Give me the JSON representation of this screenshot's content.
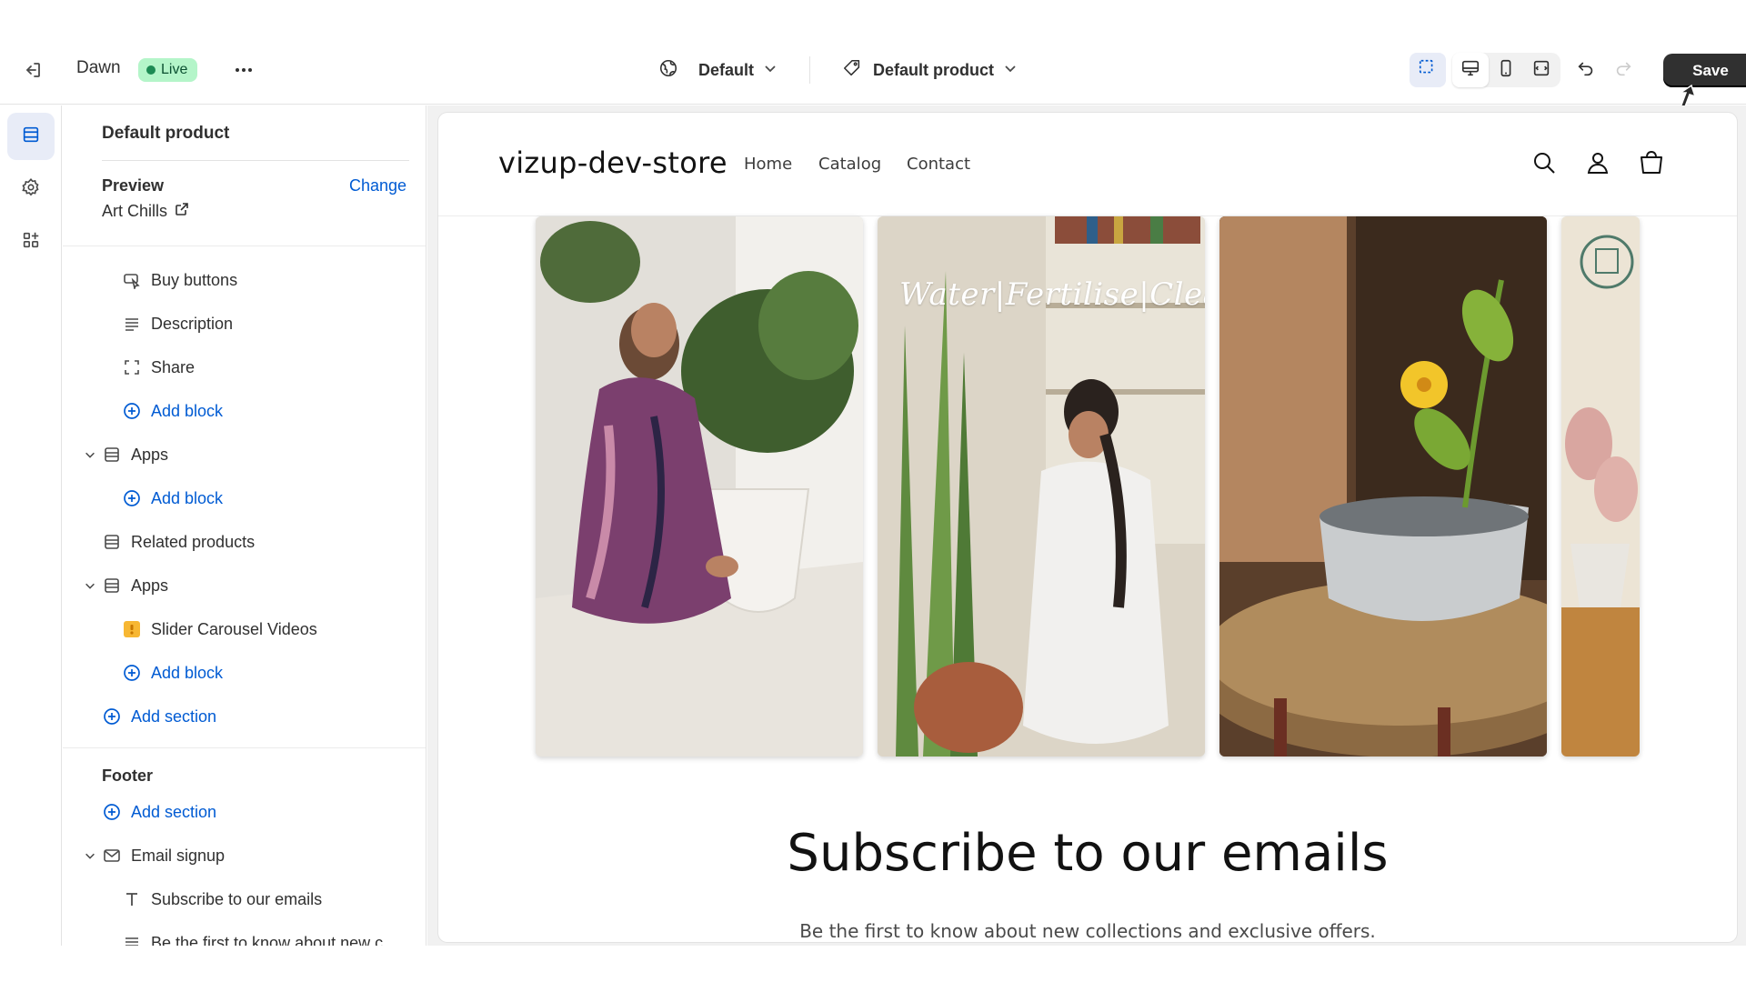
{
  "topbar": {
    "theme_name": "Dawn",
    "live_badge": "Live",
    "template_select": "Default",
    "page_select": "Default product",
    "save_label": "Save"
  },
  "sidebar": {
    "title": "Default product",
    "preview_label": "Preview",
    "change_label": "Change",
    "preview_value": "Art Chills",
    "rows": [
      {
        "label": "Buy buttons",
        "icon": "buy-buttons-icon"
      },
      {
        "label": "Description",
        "icon": "text-lines-icon"
      },
      {
        "label": "Share",
        "icon": "share-frame-icon"
      },
      {
        "label": "Add block",
        "icon": "plus-circle-icon"
      },
      {
        "label": "Apps",
        "icon": "section-icon"
      },
      {
        "label": "Add block",
        "icon": "plus-circle-icon"
      },
      {
        "label": "Related products",
        "icon": "section-icon"
      },
      {
        "label": "Apps",
        "icon": "section-icon"
      },
      {
        "label": "Slider Carousel Videos",
        "icon": "app-block-icon"
      },
      {
        "label": "Add block",
        "icon": "plus-circle-icon"
      },
      {
        "label": "Add section",
        "icon": "plus-circle-icon"
      }
    ],
    "footer_label": "Footer",
    "footer_rows": [
      {
        "label": "Add section",
        "icon": "plus-circle-icon"
      },
      {
        "label": "Email signup",
        "icon": "mail-icon"
      },
      {
        "label": "Subscribe to our emails",
        "icon": "heading-t-icon"
      },
      {
        "label": "Be the first to know about new c",
        "icon": "text-lines-icon"
      }
    ]
  },
  "store": {
    "name": "vizup-dev-store",
    "nav": [
      "Home",
      "Catalog",
      "Contact"
    ],
    "video_overlay_text": "Water|Fertilise|Clean",
    "subscribe_title": "Subscribe to our emails",
    "subscribe_text": "Be the first to know about new collections and exclusive offers."
  },
  "colors": {
    "accent_blue": "#005bd3",
    "live_badge_bg": "#b4f5c9",
    "save_bg": "#303030"
  }
}
